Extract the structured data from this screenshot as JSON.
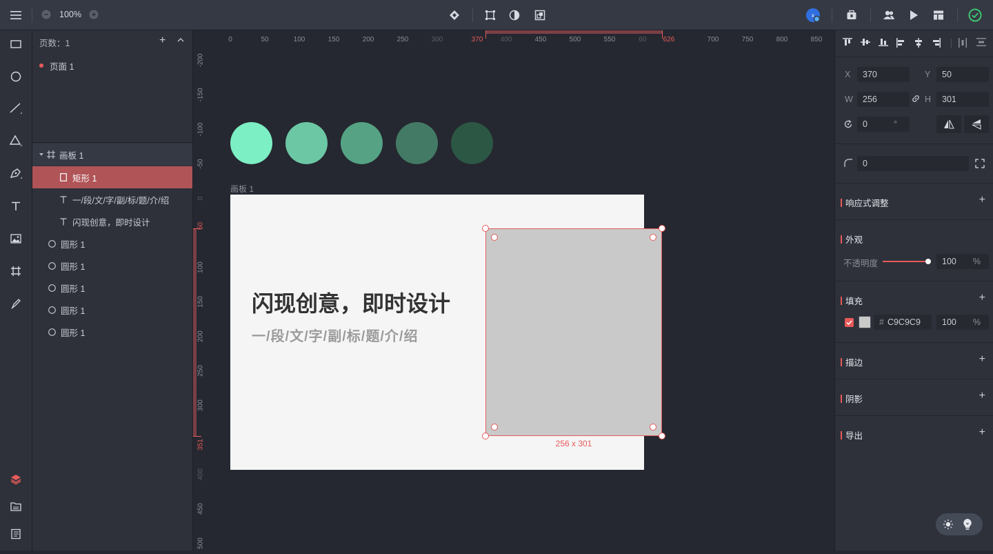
{
  "topbar": {
    "zoom": "100%"
  },
  "layers": {
    "page_count_label": "页数：1",
    "pages": [
      {
        "label": "页面 1"
      }
    ],
    "tree": [
      {
        "label": "画板 1",
        "type": "artboard"
      },
      {
        "label": "矩形 1",
        "type": "rect",
        "selected": true
      },
      {
        "label": "一/段/文/字/副/标/题/介/绍",
        "type": "text"
      },
      {
        "label": "闪现创意，即时设计",
        "type": "text"
      },
      {
        "label": "圆形 1",
        "type": "ellipse"
      },
      {
        "label": "圆形 1",
        "type": "ellipse"
      },
      {
        "label": "圆形 1",
        "type": "ellipse"
      },
      {
        "label": "圆形 1",
        "type": "ellipse"
      },
      {
        "label": "圆形 1",
        "type": "ellipse"
      }
    ]
  },
  "rulers": {
    "h_ticks": [
      "0",
      "50",
      "100",
      "150",
      "200",
      "250",
      "300",
      "370",
      "400",
      "450",
      "500",
      "550",
      "60",
      "626",
      "700",
      "750",
      "800",
      "850"
    ],
    "v_ticks": [
      "-200",
      "-150",
      "-100",
      "-50",
      "0",
      "50",
      "100",
      "150",
      "200",
      "250",
      "300",
      "351",
      "400",
      "450",
      "500"
    ]
  },
  "canvas": {
    "artboard_label": "画板 1",
    "headline": "闪现创意，即时设计",
    "subline": "一/段/文/字/副/标/题/介/绍",
    "circle_colors": [
      "#7defc4",
      "#6cc7a5",
      "#55a384",
      "#437a65",
      "#2c5745"
    ],
    "rect_fill": "#C9C9C9",
    "dimension_label": "256 x 301",
    "accent": "#e85a5a"
  },
  "inspector": {
    "x_label": "X",
    "x": "370",
    "y_label": "Y",
    "y": "50",
    "w_label": "W",
    "w": "256",
    "h_label": "H",
    "h": "301",
    "rotation": "0",
    "degree": "°",
    "radius": "0",
    "responsive": "响应式调整",
    "appearance": "外观",
    "opacity_label": "不透明度",
    "opacity": "100",
    "opacity_unit": "%",
    "opacity_level": 1.0,
    "fill_title": "填充",
    "fill_hash": "#",
    "fill_hex": "C9C9C9",
    "fill_opacity": "100",
    "fill_unit": "%",
    "stroke_title": "描边",
    "shadow_title": "阴影",
    "export_title": "导出"
  }
}
